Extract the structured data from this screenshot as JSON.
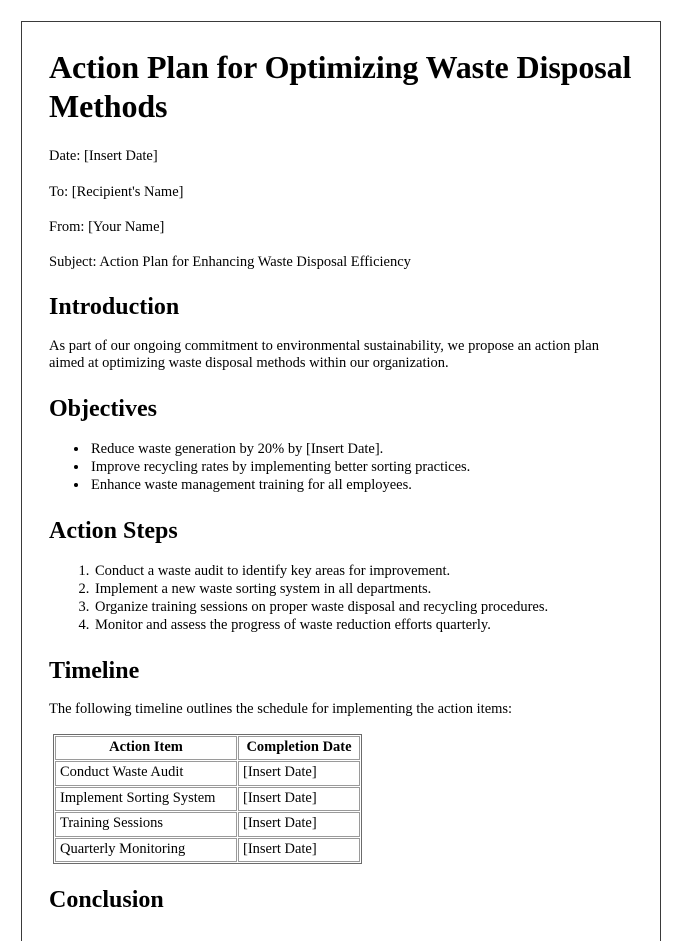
{
  "document": {
    "title": "Action Plan for Optimizing Waste Disposal Methods",
    "meta": {
      "date": "Date: [Insert Date]",
      "to": "To: [Recipient's Name]",
      "from": "From: [Your Name]",
      "subject": "Subject: Action Plan for Enhancing Waste Disposal Efficiency"
    },
    "introduction": {
      "heading": "Introduction",
      "paragraph": "As part of our ongoing commitment to environmental sustainability, we propose an action plan aimed at optimizing waste disposal methods within our organization."
    },
    "objectives": {
      "heading": "Objectives",
      "items": [
        "Reduce waste generation by 20% by [Insert Date].",
        "Improve recycling rates by implementing better sorting practices.",
        "Enhance waste management training for all employees."
      ]
    },
    "action_steps": {
      "heading": "Action Steps",
      "items": [
        "Conduct a waste audit to identify key areas for improvement.",
        "Implement a new waste sorting system in all departments.",
        "Organize training sessions on proper waste disposal and recycling procedures.",
        "Monitor and assess the progress of waste reduction efforts quarterly."
      ]
    },
    "timeline": {
      "heading": "Timeline",
      "intro": "The following timeline outlines the schedule for implementing the action items:",
      "table": {
        "columns": [
          "Action Item",
          "Completion Date"
        ],
        "rows": [
          [
            "Conduct Waste Audit",
            "[Insert Date]"
          ],
          [
            "Implement Sorting System",
            "[Insert Date]"
          ],
          [
            "Training Sessions",
            "[Insert Date]"
          ],
          [
            "Quarterly Monitoring",
            "[Insert Date]"
          ]
        ]
      }
    },
    "conclusion": {
      "heading": "Conclusion"
    }
  }
}
